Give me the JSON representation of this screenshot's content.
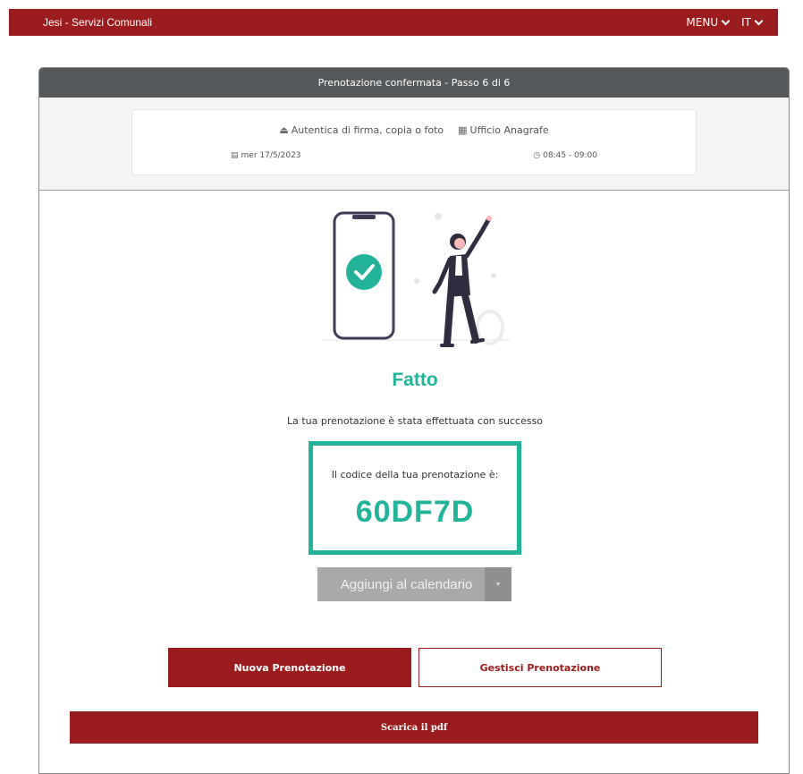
{
  "topbar": {
    "brand": "Jesi - Servizi Comunali",
    "menu_label": "MENU",
    "lang_label": "IT"
  },
  "panel": {
    "header": "Prenotazione confermata - Passo 6 di 6",
    "summary": {
      "service_icon": "eject-icon",
      "service": "Autentica di firma, copia o foto",
      "office_icon": "building-icon",
      "office": "Ufficio Anagrafe",
      "date_icon": "calendar-icon",
      "date": "mer 17/5/2023",
      "time_icon": "clock-icon",
      "time": "08:45 - 09:00"
    }
  },
  "result": {
    "title": "Fatto",
    "message": "La tua prenotazione è stata effettuata con successo",
    "code_label": "Il codice della tua prenotazione è:",
    "code": "60DF7D"
  },
  "actions": {
    "calendar_label": "Aggiungi al calendario",
    "calendar_caret": "▼",
    "new_booking": "Nuova Prenotazione",
    "manage_booking": "Gestisci Prenotazione",
    "download_pdf": "Scarica il pdf"
  },
  "colors": {
    "brand_red": "#9b1c1c",
    "accent_teal": "#23b39a",
    "header_grey": "#55595c",
    "button_grey": "#a9a9a9"
  }
}
